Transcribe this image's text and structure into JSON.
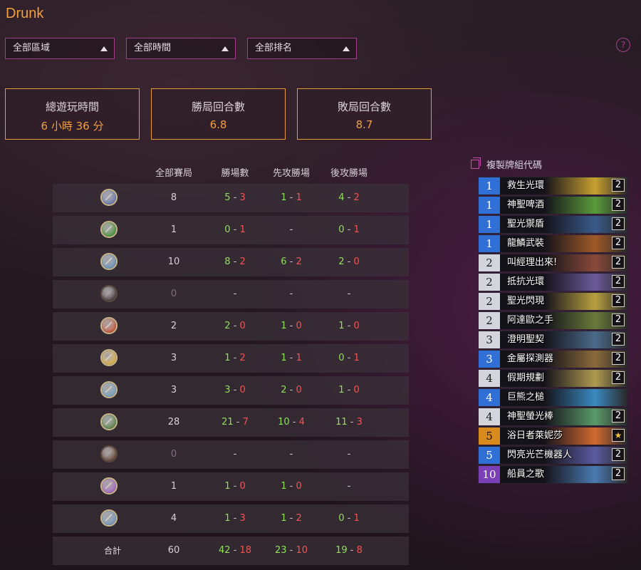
{
  "title": "Drunk",
  "filters": [
    {
      "label": "全部區域"
    },
    {
      "label": "全部時間"
    },
    {
      "label": "全部排名"
    }
  ],
  "help_label": "?",
  "stats": [
    {
      "label": "總遊玩時間",
      "value": "6 小時 36 分"
    },
    {
      "label": "勝局回合數",
      "value": "6.8"
    },
    {
      "label": "敗局回合數",
      "value": "8.7"
    }
  ],
  "table": {
    "headers": [
      "全部賽局",
      "勝場數",
      "先攻勝場",
      "後攻勝場"
    ],
    "rows": [
      {
        "icon": "mage-class-icon",
        "games": "8",
        "wins": "5",
        "losses": "3",
        "first_w": "1",
        "first_l": "1",
        "second_w": "4",
        "second_l": "2",
        "color": "#5a6ea8"
      },
      {
        "icon": "warlock-class-icon",
        "games": "1",
        "wins": "0",
        "losses": "1",
        "first_w": "",
        "first_l": "",
        "first_dash": "-",
        "second_w": "0",
        "second_l": "1",
        "color": "#3a8a2a"
      },
      {
        "icon": "shaman-class-icon",
        "games": "10",
        "wins": "8",
        "losses": "2",
        "first_w": "6",
        "first_l": "2",
        "second_w": "2",
        "second_l": "0",
        "color": "#5a8ab0"
      },
      {
        "icon": "rogue-class-icon",
        "games": "0",
        "dim": true,
        "color": "#3a3030"
      },
      {
        "icon": "warrior-class-icon",
        "games": "2",
        "wins": "2",
        "losses": "0",
        "first_w": "1",
        "first_l": "0",
        "second_w": "1",
        "second_l": "0",
        "color": "#c0482a"
      },
      {
        "icon": "paladin-class-icon",
        "games": "3",
        "wins": "1",
        "losses": "2",
        "first_w": "1",
        "first_l": "1",
        "second_w": "0",
        "second_l": "1",
        "color": "#d8a838"
      },
      {
        "icon": "priest-class-icon",
        "games": "3",
        "wins": "3",
        "losses": "0",
        "first_w": "2",
        "first_l": "0",
        "second_w": "1",
        "second_l": "0",
        "color": "#6a9ab8"
      },
      {
        "icon": "hunter-class-icon",
        "games": "28",
        "wins": "21",
        "losses": "7",
        "first_w": "10",
        "first_l": "4",
        "second_w": "11",
        "second_l": "3",
        "color": "#4a7a3a"
      },
      {
        "icon": "druid-class-icon",
        "games": "0",
        "dim": true,
        "color": "#5a3a28"
      },
      {
        "icon": "demon-hunter-class-icon",
        "games": "1",
        "wins": "1",
        "losses": "0",
        "first_w": "1",
        "first_l": "0",
        "second_w": "",
        "second_l": "",
        "second_dash": "-",
        "color": "#9a5ab8"
      },
      {
        "icon": "death-knight-class-icon",
        "games": "4",
        "wins": "1",
        "losses": "3",
        "first_w": "1",
        "first_l": "2",
        "second_w": "0",
        "second_l": "1",
        "color": "#6a90b8"
      }
    ],
    "total": {
      "label": "合計",
      "games": "60",
      "wins": "42",
      "losses": "18",
      "first_w": "23",
      "first_l": "10",
      "second_w": "19",
      "second_l": "8"
    }
  },
  "deck": {
    "copy_label": "複製牌組代碼",
    "cards": [
      {
        "cost": "1",
        "name": "救生光環",
        "count": "2",
        "rarity": "rare",
        "art": "#c8a030"
      },
      {
        "cost": "1",
        "name": "神聖啤酒",
        "count": "2",
        "rarity": "rare",
        "art": "#5a9a3a"
      },
      {
        "cost": "1",
        "name": "聖光禦盾",
        "count": "2",
        "rarity": "rare",
        "art": "#3a5a8a"
      },
      {
        "cost": "1",
        "name": "龍鱗武裝",
        "count": "2",
        "rarity": "rare",
        "art": "#a05a28"
      },
      {
        "cost": "2",
        "name": "叫經理出來!",
        "count": "2",
        "rarity": "common",
        "art": "#8a4a3a"
      },
      {
        "cost": "2",
        "name": "抵抗光環",
        "count": "2",
        "rarity": "common",
        "art": "#6a5a9a"
      },
      {
        "cost": "2",
        "name": "聖光閃現",
        "count": "2",
        "rarity": "common",
        "art": "#b8a040"
      },
      {
        "cost": "2",
        "name": "阿達歐之手",
        "count": "2",
        "rarity": "common",
        "art": "#6a7a3a"
      },
      {
        "cost": "3",
        "name": "澄明聖契",
        "count": "2",
        "rarity": "common",
        "art": "#4a6a8a"
      },
      {
        "cost": "3",
        "name": "金屬探測器",
        "count": "2",
        "rarity": "rare",
        "art": "#8a6a3a"
      },
      {
        "cost": "4",
        "name": "假期規劃",
        "count": "2",
        "rarity": "common",
        "art": "#b09a50"
      },
      {
        "cost": "4",
        "name": "巨熊之槌",
        "count": "",
        "rarity": "rare",
        "art": "#3a8ac0"
      },
      {
        "cost": "4",
        "name": "神聖螢光棒",
        "count": "2",
        "rarity": "common",
        "art": "#5a9a6a"
      },
      {
        "cost": "5",
        "name": "浴日者萊妮莎",
        "count": "★",
        "rarity": "legendary",
        "art": "#d06a30"
      },
      {
        "cost": "5",
        "name": "閃亮光芒機器人",
        "count": "2",
        "rarity": "rare",
        "art": "#5a5aa0"
      },
      {
        "cost": "10",
        "name": "船員之歌",
        "count": "2",
        "rarity": "epic",
        "art": "#4a7ab0"
      }
    ]
  },
  "colors": {
    "accent": "#f0a040",
    "filter_border": "#a0408c",
    "win": "#8fe05a",
    "loss": "#f05555",
    "rarity_common": "#d4d4dc",
    "rarity_rare": "#2f6fd6",
    "rarity_epic": "#7b3fb8",
    "rarity_legendary": "#d98a1c"
  }
}
